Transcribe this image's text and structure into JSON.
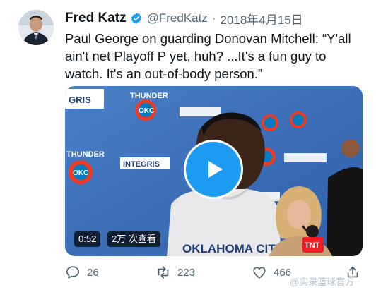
{
  "tweet": {
    "author_name": "Fred Katz",
    "author_handle": "@FredKatz",
    "separator": "·",
    "date": "2018年4月15日",
    "text": "Paul George on guarding Donovan Mitchell: “Y'all ain't net Playoff P yet, huh? ...It's a fun guy to watch. It's an out-of-body person.”"
  },
  "media": {
    "duration": "0:52",
    "views": "2万 次查看",
    "backdrop_text": [
      "THUNDER",
      "OKC",
      "INTEGRIS",
      "GRIS",
      "OKLAHOMA CITY",
      "TNT"
    ]
  },
  "actions": {
    "reply_count": "26",
    "retweet_count": "223",
    "like_count": "466"
  },
  "watermark": "@实录篮球官方",
  "colors": {
    "accent": "#1d9bf0",
    "thunder_orange": "#ef3b24",
    "thunder_blue": "#007ac1"
  }
}
